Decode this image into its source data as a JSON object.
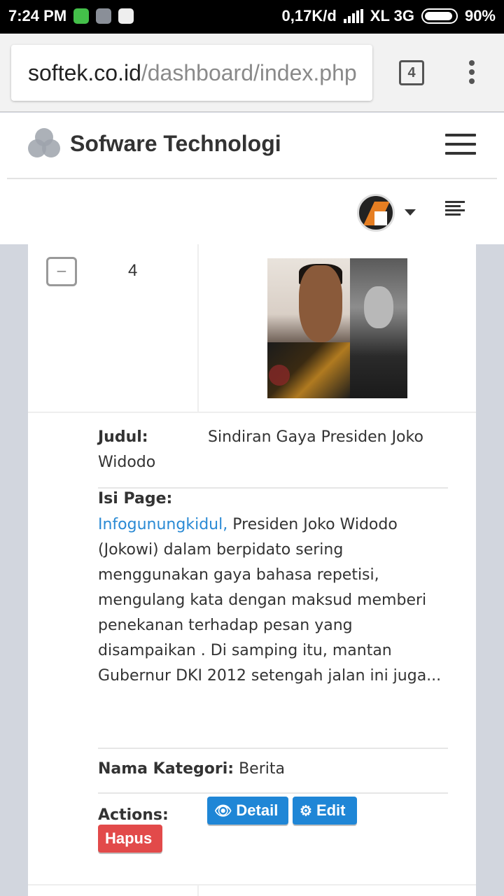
{
  "status_bar": {
    "time": "7:24 PM",
    "net_speed": "0,17K/d",
    "carrier": "XL 3G",
    "battery": "90%"
  },
  "browser": {
    "url_host": "softek.co.id",
    "url_path": "/dashboard/index.php",
    "tab_count": "4"
  },
  "header": {
    "brand": "Sofware Technologi"
  },
  "record": {
    "number": "4",
    "collapse_symbol": "−",
    "judul_label": "Judul:",
    "judul_line1": "Sindiran Gaya Presiden Joko",
    "judul_line2": "Widodo",
    "isi_label": "Isi Page:",
    "isi_link": "Infogunungkidul,",
    "isi_text": " Presiden Joko Widodo (Jokowi) dalam berpidato sering menggunakan gaya bahasa repetisi, mengulang kata dengan maksud memberi penekanan terhadap pesan yang disampaikan . Di samping itu, mantan Gubernur DKI 2012 setengah jalan ini juga...",
    "kategori_label": "Nama Kategori:",
    "kategori_value": "Berita",
    "actions_label": "Actions:",
    "detail_label": "Detail",
    "edit_label": "Edit",
    "hapus_label": "Hapus"
  },
  "colors": {
    "primary_button": "#1f86d6",
    "danger_button": "#e24a4a",
    "link": "#2a8ad4"
  },
  "icons": [
    "shield-icon",
    "bbm-icon",
    "signal-icon",
    "battery-icon",
    "tabs-icon",
    "more-vert-icon",
    "logo-icon",
    "hamburger-icon",
    "avatar",
    "caret-down-icon",
    "align-left-icon",
    "eye-icon",
    "gear-icon"
  ]
}
